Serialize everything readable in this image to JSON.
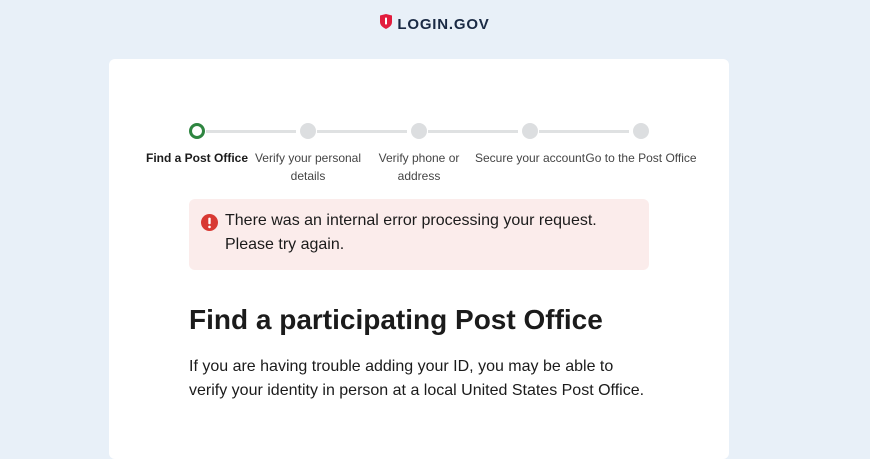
{
  "header": {
    "logo_text": "LOGIN.GOV",
    "logo_icon": "shield-icon",
    "brand_color": "#e21c3d"
  },
  "steps": [
    {
      "label": "Find a Post Office",
      "status": "current"
    },
    {
      "label": "Verify your personal details",
      "status": "upcoming"
    },
    {
      "label": "Verify phone or address",
      "status": "upcoming"
    },
    {
      "label": "Secure your account",
      "status": "upcoming"
    },
    {
      "label": "Go to the Post Office",
      "status": "upcoming"
    }
  ],
  "alert": {
    "icon": "error-icon",
    "message": "There was an internal error processing your request. Please try again.",
    "color": "#d83933",
    "background": "#fbeceb"
  },
  "main": {
    "heading": "Find a participating Post Office",
    "intro": "If you are having trouble adding your ID, you may be able to verify your identity in person at a local United States Post Office."
  },
  "colors": {
    "page_background": "#e8f0f8",
    "step_current": "#2e8540",
    "step_upcoming": "#dcdee0"
  }
}
